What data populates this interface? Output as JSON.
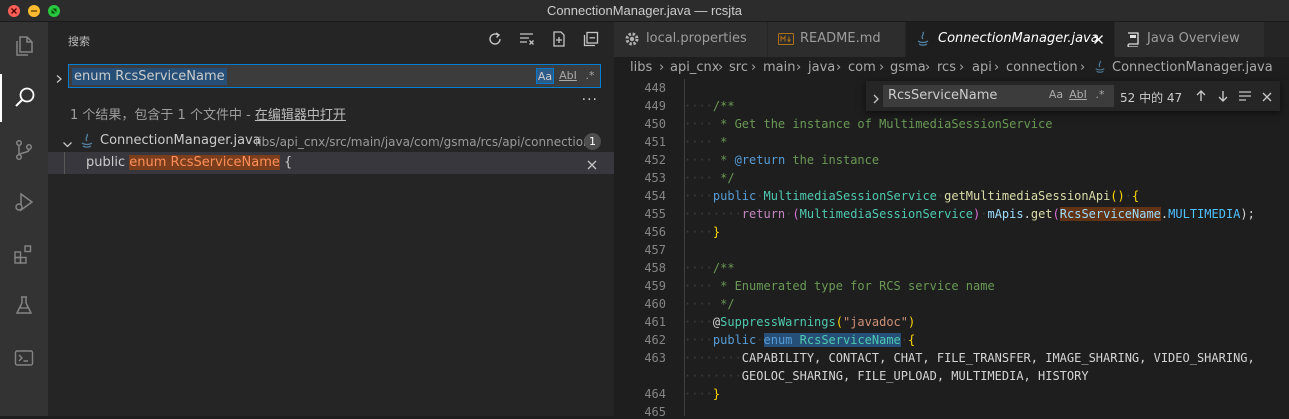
{
  "window": {
    "title": "ConnectionManager.java — rcsjta"
  },
  "sidebar": {
    "title": "搜索",
    "search": {
      "value": "enum RcsServiceName",
      "toggle_case": "Aa",
      "toggle_word": "AbI",
      "toggle_regex": ".*"
    },
    "summary_prefix": "1 个结果，包含于 1 个文件中 - ",
    "open_in_editor": "在编辑器中打开",
    "file": {
      "name": "ConnectionManager.java",
      "path": "libs/api_cnx/src/main/java/com/gsma/rcs/api/connection",
      "count": "1"
    },
    "match": {
      "before": "public ",
      "highlight": "enum RcsServiceName",
      "after": " {"
    }
  },
  "tabs": [
    {
      "label": "local.properties",
      "icon": "gear-icon"
    },
    {
      "label": "README.md",
      "icon": "markdown-icon"
    },
    {
      "label": "ConnectionManager.java",
      "icon": "java-icon",
      "active": true
    },
    {
      "label": "Java Overview",
      "icon": "book-icon"
    }
  ],
  "breadcrumb": [
    "libs",
    "api_cnx",
    "src",
    "main",
    "java",
    "com",
    "gsma",
    "rcs",
    "api",
    "connection",
    "ConnectionManager.java"
  ],
  "find": {
    "value": "RcsServiceName",
    "toggle_case": "Aa",
    "toggle_word": "AbI",
    "toggle_regex": ".*",
    "count": "52 中的 47"
  },
  "line_numbers": [
    "448",
    "449",
    "450",
    "451",
    "452",
    "453",
    "454",
    "455",
    "456",
    "457",
    "458",
    "459",
    "460",
    "461",
    "462",
    "463",
    "",
    "464",
    "465"
  ],
  "code": {
    "l449": "/**",
    "l450": " * Get the instance of MultimediaSessionService",
    "l451": " *",
    "l452_a": " * ",
    "l452_b": "@return",
    "l452_c": " the instance",
    "l453": " */",
    "l454_kw": "public",
    "l454_ty": "MultimediaSessionService",
    "l454_fn": "getMultimediaSessionApi",
    "l454_p": "()",
    "l454_b": "{",
    "l455_kw": "return",
    "l455_p1": "(",
    "l455_ty": "MultimediaSessionService",
    "l455_p2": ")",
    "l455_id": "mApis",
    "l455_dot": ".",
    "l455_fn": "get",
    "l455_p3": "(",
    "l455_m": "RcsServiceName",
    "l455_dot2": ".",
    "l455_c": "MULTIMEDIA",
    "l455_end": ");",
    "l456": "}",
    "l458": "/**",
    "l459": " * Enumerated type for RCS service name",
    "l460": " */",
    "l461_at": "@",
    "l461_an": "SuppressWarnings",
    "l461_p1": "(",
    "l461_st": "\"javadoc\"",
    "l461_p2": ")",
    "l462_kw": "public",
    "l462_en": "enum",
    "l462_ty": "RcsServiceName",
    "l462_b": "{",
    "l463a": "CAPABILITY, CONTACT, CHAT, FILE_TRANSFER, IMAGE_SHARING, VIDEO_SHARING,",
    "l463b": "GEOLOC_SHARING, FILE_UPLOAD, MULTIMEDIA, HISTORY",
    "l464": "}"
  }
}
